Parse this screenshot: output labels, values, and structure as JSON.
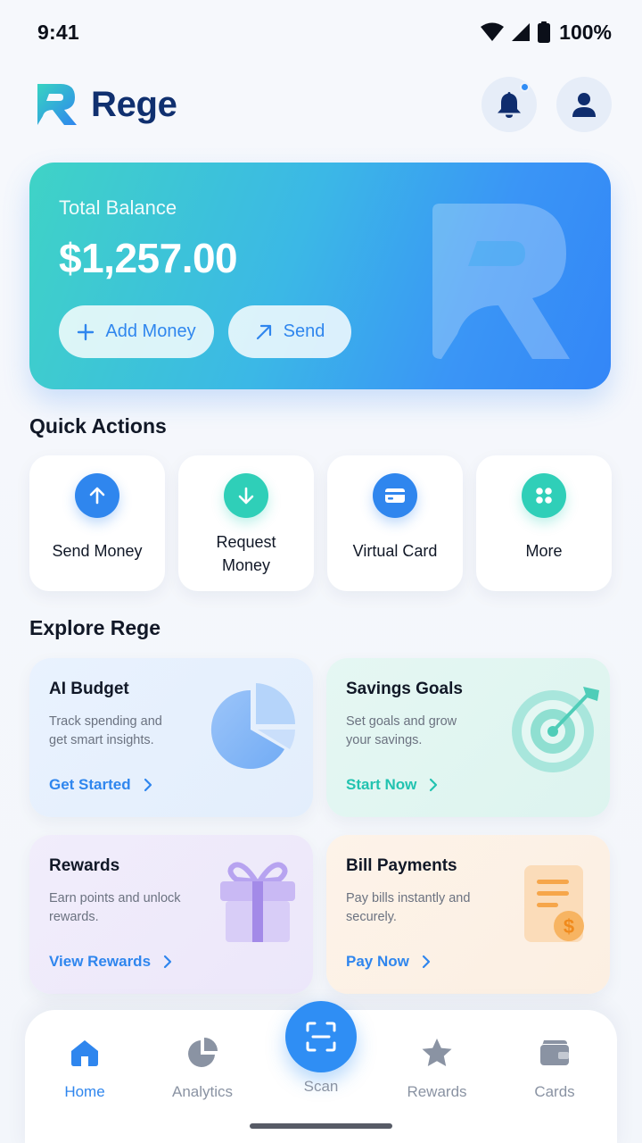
{
  "status_bar": {
    "time": "9:41",
    "battery": "100%"
  },
  "header": {
    "brand_name": "Rege",
    "has_notification": true
  },
  "balance": {
    "label": "Total Balance",
    "amount": "$1,257.00",
    "add_money_label": "Add Money",
    "send_label": "Send"
  },
  "quick_actions": {
    "title": "Quick Actions",
    "items": [
      {
        "label": "Send Money",
        "icon": "arrow-up-icon",
        "color": "#2f86ee"
      },
      {
        "label": "Request Money",
        "icon": "arrow-down-icon",
        "color": "#2fcfb8"
      },
      {
        "label": "Virtual Card",
        "icon": "card-icon",
        "color": "#2f86ee"
      },
      {
        "label": "More",
        "icon": "grid-icon",
        "color": "#2fcfb8"
      }
    ]
  },
  "explore": {
    "title": "Explore Rege",
    "cards": [
      {
        "title": "AI Budget",
        "desc": "Track spending and get smart insights.",
        "link": "Get Started",
        "link_color": "#2f86ee",
        "icon": "pie-chart-icon"
      },
      {
        "title": "Savings Goals",
        "desc": "Set goals and grow your savings.",
        "link": "Start Now",
        "link_color": "#22c3b0",
        "icon": "target-icon"
      },
      {
        "title": "Rewards",
        "desc": "Earn points and unlock rewards.",
        "link": "View Rewards",
        "link_color": "#2f86ee",
        "icon": "gift-icon"
      },
      {
        "title": "Bill Payments",
        "desc": "Pay bills instantly and securely.",
        "link": "Pay Now",
        "link_color": "#2f86ee",
        "icon": "bill-icon"
      }
    ]
  },
  "bottom_nav": {
    "items": [
      {
        "label": "Home",
        "icon": "home-icon",
        "active": true
      },
      {
        "label": "Analytics",
        "icon": "analytics-icon",
        "active": false
      },
      {
        "label": "Scan",
        "icon": "scan-icon",
        "active": false
      },
      {
        "label": "Rewards",
        "icon": "star-icon",
        "active": false
      },
      {
        "label": "Cards",
        "icon": "wallet-icon",
        "active": false
      }
    ]
  },
  "colors": {
    "primary": "#2f86ee",
    "teal": "#2fcfb8",
    "brand_text": "#10306f"
  }
}
